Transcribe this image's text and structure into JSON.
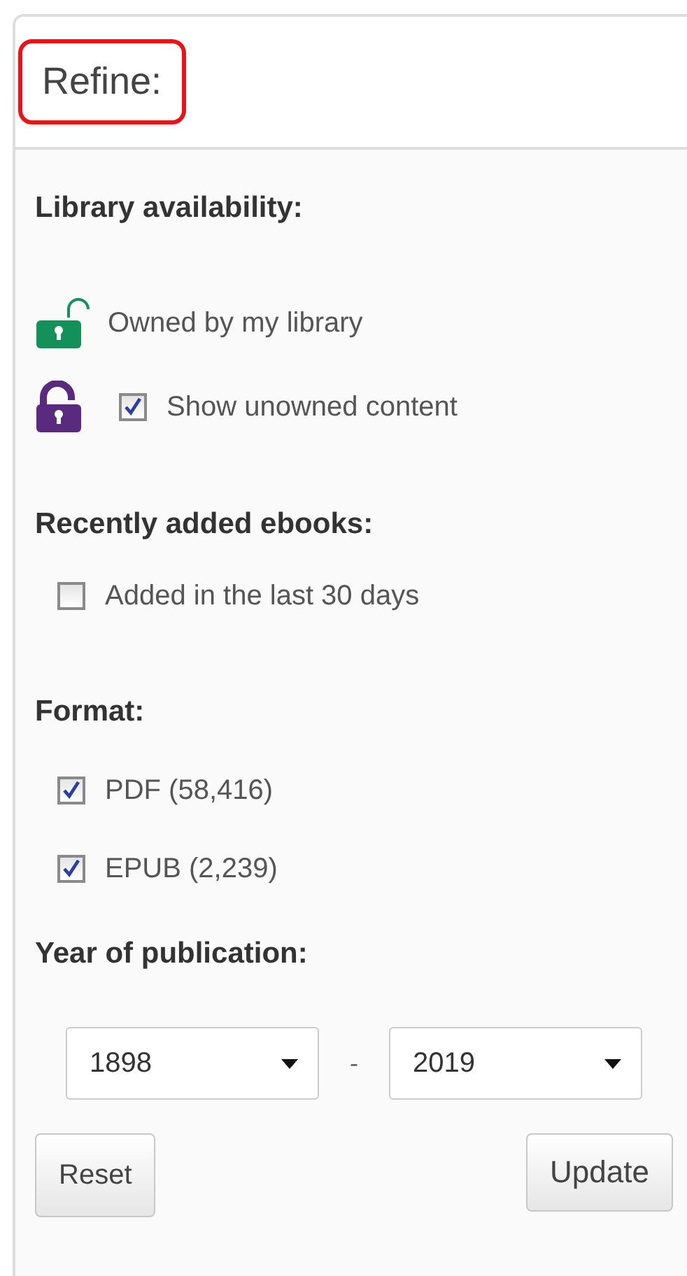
{
  "panel": {
    "title": "Refine:",
    "title_highlighted": true
  },
  "sections": [
    {
      "kind": "availability",
      "heading": "Library availability:",
      "items": [
        {
          "kind": "status",
          "label": "Owned by my library",
          "color": "#14905a"
        },
        {
          "kind": "checkbox",
          "label": "Show unowned content",
          "checked": true,
          "color": "#5a2a7e"
        }
      ]
    },
    {
      "kind": "checklist",
      "heading": "Recently added ebooks:",
      "items": [
        {
          "label": "Added in the last 30 days",
          "checked": false
        }
      ]
    },
    {
      "kind": "checklist",
      "heading": "Format:",
      "items": [
        {
          "label": "PDF (58,416)",
          "checked": true
        },
        {
          "label": "EPUB (2,239)",
          "checked": true
        }
      ]
    },
    {
      "kind": "range",
      "heading": "Year of publication:",
      "from": "1898",
      "separator": "-",
      "to": "2019"
    }
  ],
  "buttons": [
    {
      "label": "Reset",
      "kind": "secondary"
    },
    {
      "label": "Update",
      "kind": "primary"
    }
  ]
}
